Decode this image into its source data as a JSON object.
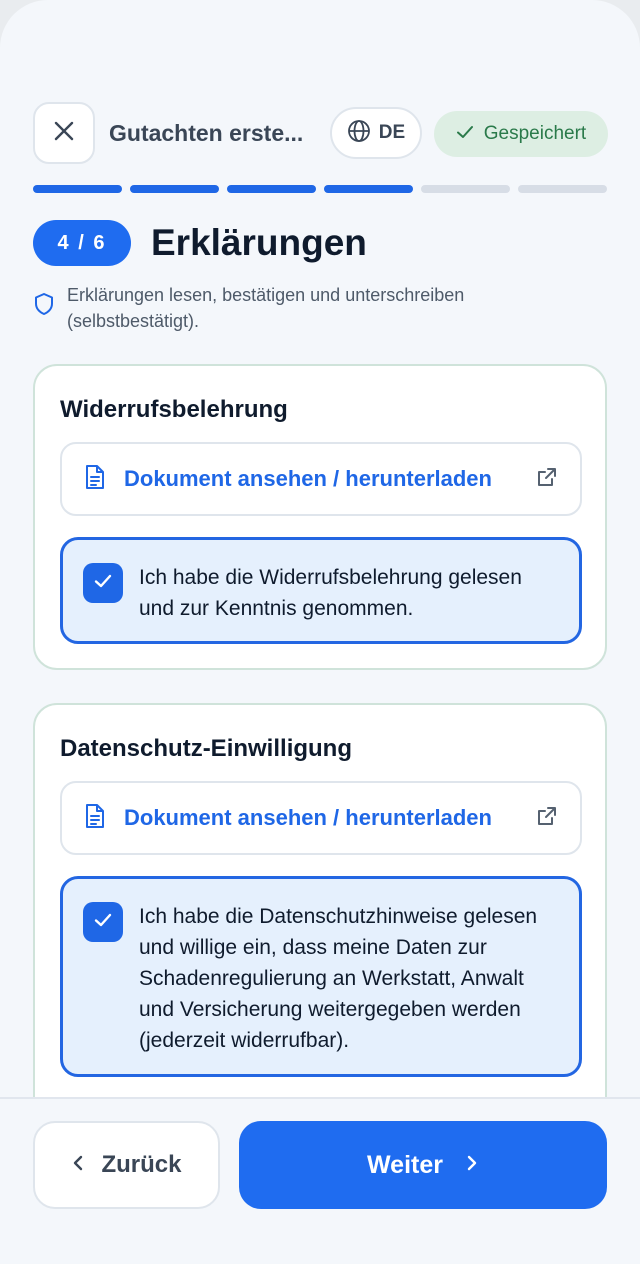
{
  "header": {
    "title": "Gutachten erste...",
    "language": "DE",
    "saved_label": "Gespeichert"
  },
  "progress": {
    "total_steps": 6,
    "completed_steps": 4
  },
  "step": {
    "badge": "4 / 6",
    "title": "Erklärungen",
    "subtitle": "Erklärungen lesen, bestätigen und unterschreiben (selbstbestätigt)."
  },
  "cards": [
    {
      "title": "Widerrufsbelehrung",
      "doc_link": "Dokument ansehen / herunterladen",
      "consent_text": "Ich habe die Widerrufsbelehrung gelesen und zur Kenntnis genommen.",
      "checked": true
    },
    {
      "title": "Datenschutz-Einwilligung",
      "doc_link": "Dokument ansehen / herunterladen",
      "consent_text": "Ich habe die Datenschutzhinweise gelesen und willige ein, dass meine Daten zur Schadenregulierung an Werkstatt, Anwalt und Versicherung weitergegeben werden (jederzeit widerrufbar).",
      "checked": true
    }
  ],
  "footer": {
    "back_label": "Zurück",
    "next_label": "Weiter"
  },
  "icons": {
    "close": "close-icon",
    "language": "globe-icon",
    "saved": "check-icon",
    "shield": "shield-icon",
    "document": "document-icon",
    "external": "external-link-icon",
    "checkbox": "check-icon",
    "back": "chevron-left-icon",
    "next": "chevron-right-icon"
  },
  "colors": {
    "accent": "#1f6cf0",
    "saved_bg": "#ddeee3",
    "saved_text": "#2a7a4a",
    "consent_bg": "#e5f0fd"
  }
}
